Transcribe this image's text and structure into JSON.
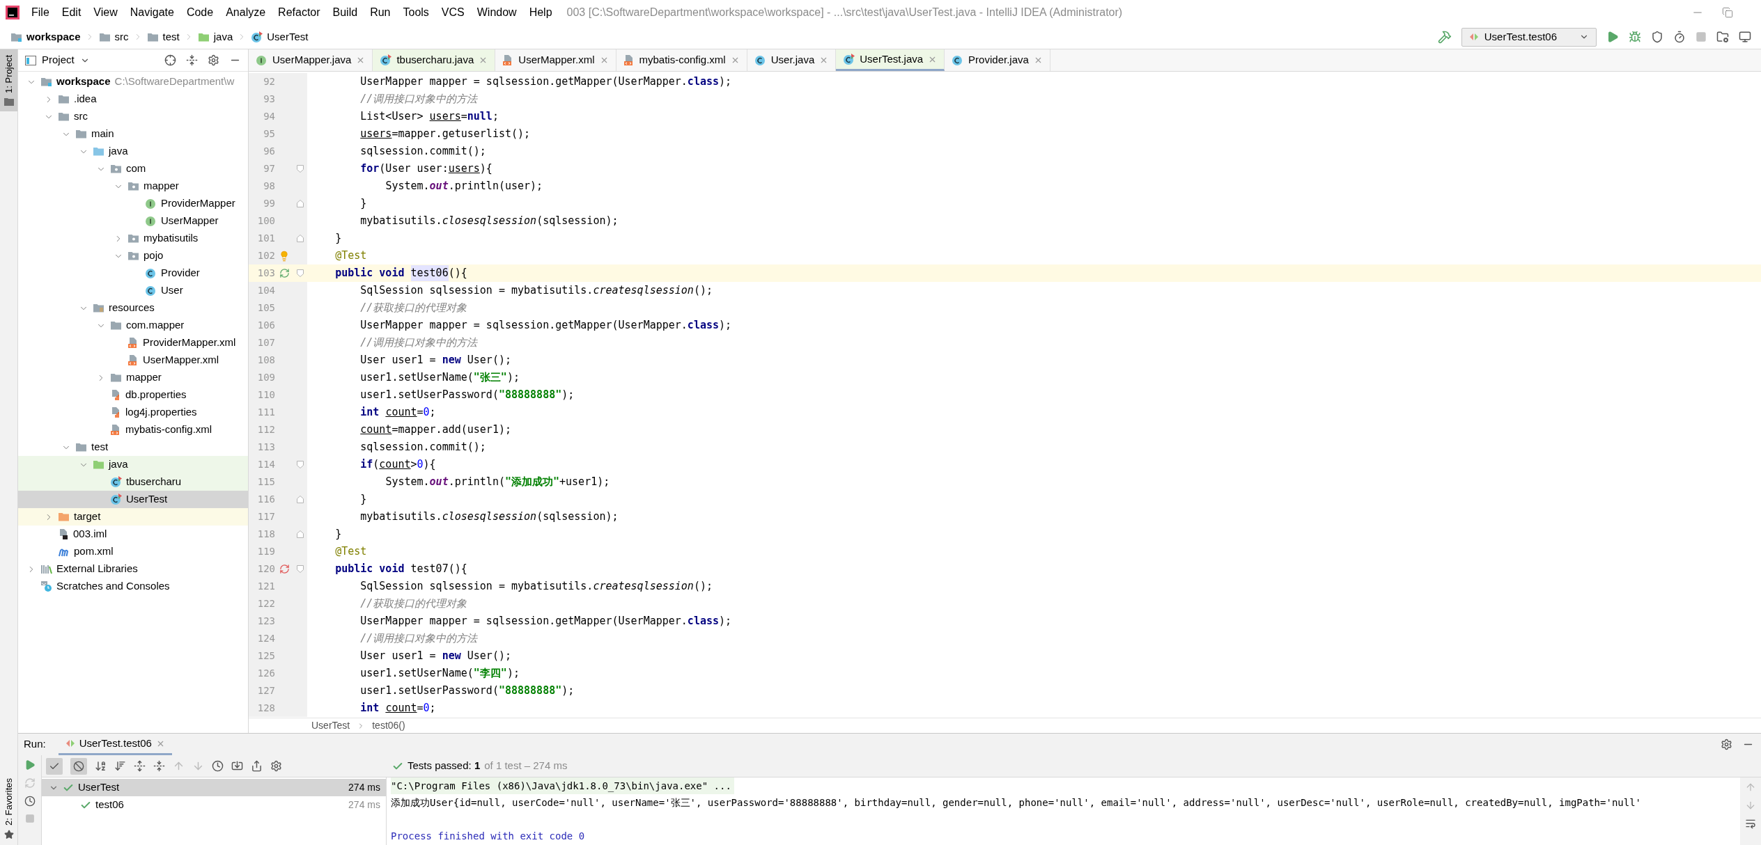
{
  "title_bar": {
    "menu": [
      "File",
      "Edit",
      "View",
      "Navigate",
      "Code",
      "Analyze",
      "Refactor",
      "Build",
      "Run",
      "Tools",
      "VCS",
      "Window",
      "Help"
    ],
    "title": "003 [C:\\SoftwareDepartment\\workspace\\workspace] - ...\\src\\test\\java\\UserTest.java - IntelliJ IDEA (Administrator)"
  },
  "nav_bar": {
    "breadcrumb": [
      {
        "label": "workspace",
        "kind": "module"
      },
      {
        "label": "src",
        "kind": "folder"
      },
      {
        "label": "test",
        "kind": "folder"
      },
      {
        "label": "java",
        "kind": "test-root"
      },
      {
        "label": "UserTest",
        "kind": "test-class"
      }
    ],
    "run_config": "UserTest.test06"
  },
  "tool_strip": [
    {
      "label": "1: Project",
      "kind": "project",
      "selected": true
    },
    {
      "label": "2: Favorites",
      "kind": "favorites",
      "selected": false
    }
  ],
  "project_panel": {
    "title": "Project",
    "tree": [
      {
        "label": "workspace",
        "kind": "module",
        "path": "C:\\SoftwareDepartment\\w",
        "expanded": true,
        "selected": false,
        "children": [
          {
            "label": ".idea",
            "kind": "folder",
            "expanded": false,
            "selected": false
          },
          {
            "label": "src",
            "kind": "folder",
            "expanded": true,
            "selected": false,
            "children": [
              {
                "label": "main",
                "kind": "folder",
                "expanded": true,
                "selected": false,
                "children": [
                  {
                    "label": "java",
                    "kind": "source-root",
                    "expanded": true,
                    "selected": false,
                    "children": [
                      {
                        "label": "com",
                        "kind": "package",
                        "expanded": true,
                        "selected": false,
                        "children": [
                          {
                            "label": "mapper",
                            "kind": "package",
                            "expanded": true,
                            "selected": false,
                            "children": [
                              {
                                "label": "ProviderMapper",
                                "kind": "interface",
                                "selected": false
                              },
                              {
                                "label": "UserMapper",
                                "kind": "interface",
                                "selected": false
                              }
                            ]
                          },
                          {
                            "label": "mybatisutils",
                            "kind": "package",
                            "expanded": false,
                            "selected": false
                          },
                          {
                            "label": "pojo",
                            "kind": "package",
                            "expanded": true,
                            "selected": false,
                            "children": [
                              {
                                "label": "Provider",
                                "kind": "class",
                                "selected": false
                              },
                              {
                                "label": "User",
                                "kind": "class",
                                "selected": false
                              }
                            ]
                          }
                        ]
                      }
                    ]
                  },
                  {
                    "label": "resources",
                    "kind": "resources",
                    "expanded": true,
                    "selected": false,
                    "children": [
                      {
                        "label": "com.mapper",
                        "kind": "folder",
                        "expanded": true,
                        "selected": false,
                        "children": [
                          {
                            "label": "ProviderMapper.xml",
                            "kind": "xml",
                            "selected": false
                          },
                          {
                            "label": "UserMapper.xml",
                            "kind": "xml",
                            "selected": false
                          }
                        ]
                      },
                      {
                        "label": "mapper",
                        "kind": "folder",
                        "expanded": false,
                        "selected": false
                      },
                      {
                        "label": "db.properties",
                        "kind": "properties",
                        "selected": false
                      },
                      {
                        "label": "log4j.properties",
                        "kind": "properties",
                        "selected": false
                      },
                      {
                        "label": "mybatis-config.xml",
                        "kind": "xml",
                        "selected": false
                      }
                    ]
                  }
                ]
              },
              {
                "label": "test",
                "kind": "folder",
                "expanded": true,
                "selected": false,
                "children": [
                  {
                    "label": "java",
                    "kind": "test-root",
                    "expanded": true,
                    "selected": false,
                    "children": [
                      {
                        "label": "tbusercharu",
                        "kind": "test-class",
                        "selected": false
                      },
                      {
                        "label": "UserTest",
                        "kind": "test-class",
                        "selected": true
                      }
                    ]
                  }
                ]
              }
            ]
          },
          {
            "label": "target",
            "kind": "excluded",
            "expanded": false,
            "selected": false
          },
          {
            "label": "003.iml",
            "kind": "iml",
            "selected": false
          },
          {
            "label": "pom.xml",
            "kind": "maven",
            "selected": false
          }
        ]
      },
      {
        "label": "External Libraries",
        "kind": "libraries",
        "expanded": false,
        "selected": false
      },
      {
        "label": "Scratches and Consoles",
        "kind": "scratches",
        "selected": false
      }
    ]
  },
  "editor_tabs": [
    {
      "label": "UserMapper.java",
      "kind": "interface",
      "selected": false
    },
    {
      "label": "tbusercharu.java",
      "kind": "test-class",
      "selected": false
    },
    {
      "label": "UserMapper.xml",
      "kind": "xml",
      "selected": false
    },
    {
      "label": "mybatis-config.xml",
      "kind": "xml",
      "selected": false
    },
    {
      "label": "User.java",
      "kind": "class",
      "selected": false
    },
    {
      "label": "UserTest.java",
      "kind": "test-class",
      "selected": true
    },
    {
      "label": "Provider.java",
      "kind": "class",
      "selected": false
    }
  ],
  "editor": {
    "lines": [
      {
        "number": "92",
        "tokens": [
          {
            "kind": "plain",
            "text": "        UserMapper mapper = sqlsession.getMapper(UserMapper."
          },
          {
            "kind": "keyword",
            "text": "class"
          },
          {
            "kind": "plain",
            "text": ");"
          }
        ]
      },
      {
        "number": "93",
        "tokens": [
          {
            "kind": "comment",
            "text": "        //调用接口对象中的方法"
          }
        ]
      },
      {
        "number": "94",
        "tokens": [
          {
            "kind": "plain",
            "text": "        List<User> "
          },
          {
            "kind": "reassigned",
            "text": "users"
          },
          {
            "kind": "plain",
            "text": "="
          },
          {
            "kind": "keyword",
            "text": "null"
          },
          {
            "kind": "plain",
            "text": ";"
          }
        ]
      },
      {
        "number": "95",
        "tokens": [
          {
            "kind": "reassigned",
            "text": "        users"
          },
          {
            "kind": "plain",
            "text": "=mapper.getuserlist();"
          }
        ]
      },
      {
        "number": "96",
        "tokens": [
          {
            "kind": "plain",
            "text": "        sqlsession.commit();"
          }
        ]
      },
      {
        "number": "97",
        "fold_start": true,
        "tokens": [
          {
            "kind": "keyword",
            "text": "        for"
          },
          {
            "kind": "plain",
            "text": "(User user:"
          },
          {
            "kind": "reassigned",
            "text": "users"
          },
          {
            "kind": "plain",
            "text": "){"
          }
        ]
      },
      {
        "number": "98",
        "tokens": [
          {
            "kind": "plain",
            "text": "            System."
          },
          {
            "kind": "field",
            "text": "out"
          },
          {
            "kind": "plain",
            "text": ".println(user);"
          }
        ]
      },
      {
        "number": "99",
        "fold_end": true,
        "tokens": [
          {
            "kind": "plain",
            "text": "        }"
          }
        ]
      },
      {
        "number": "100",
        "tokens": [
          {
            "kind": "plain",
            "text": "        mybatisutils."
          },
          {
            "kind": "static",
            "text": "closesqlsession"
          },
          {
            "kind": "plain",
            "text": "(sqlsession);"
          }
        ]
      },
      {
        "number": "101",
        "fold_end": true,
        "tokens": [
          {
            "kind": "plain",
            "text": "    }"
          }
        ]
      },
      {
        "number": "102",
        "intention_bulb": true,
        "tokens": [
          {
            "kind": "annotation",
            "text": "    @Test"
          }
        ]
      },
      {
        "number": "103",
        "test_passed": true,
        "fold_start": true,
        "current": true,
        "tokens": [
          {
            "kind": "keyword",
            "text": "    public void "
          },
          {
            "kind": "highlight",
            "text": "test06"
          },
          {
            "kind": "plain",
            "text": "(){"
          }
        ]
      },
      {
        "number": "104",
        "tokens": [
          {
            "kind": "plain",
            "text": "        SqlSession sqlsession = mybatisutils."
          },
          {
            "kind": "static",
            "text": "createsqlsession"
          },
          {
            "kind": "plain",
            "text": "();"
          }
        ]
      },
      {
        "number": "105",
        "tokens": [
          {
            "kind": "comment",
            "text": "        //获取接口的代理对象"
          }
        ]
      },
      {
        "number": "106",
        "tokens": [
          {
            "kind": "plain",
            "text": "        UserMapper mapper = sqlsession.getMapper(UserMapper."
          },
          {
            "kind": "keyword",
            "text": "class"
          },
          {
            "kind": "plain",
            "text": ");"
          }
        ]
      },
      {
        "number": "107",
        "tokens": [
          {
            "kind": "comment",
            "text": "        //调用接口对象中的方法"
          }
        ]
      },
      {
        "number": "108",
        "tokens": [
          {
            "kind": "plain",
            "text": "        User user1 = "
          },
          {
            "kind": "keyword",
            "text": "new"
          },
          {
            "kind": "plain",
            "text": " User();"
          }
        ]
      },
      {
        "number": "109",
        "tokens": [
          {
            "kind": "plain",
            "text": "        user1.setUserName("
          },
          {
            "kind": "string",
            "text": "\"张三\""
          },
          {
            "kind": "plain",
            "text": ");"
          }
        ]
      },
      {
        "number": "110",
        "tokens": [
          {
            "kind": "plain",
            "text": "        user1.setUserPassword("
          },
          {
            "kind": "string",
            "text": "\"88888888\""
          },
          {
            "kind": "plain",
            "text": ");"
          }
        ]
      },
      {
        "number": "111",
        "tokens": [
          {
            "kind": "keyword",
            "text": "        int "
          },
          {
            "kind": "reassigned",
            "text": "count"
          },
          {
            "kind": "plain",
            "text": "="
          },
          {
            "kind": "number",
            "text": "0"
          },
          {
            "kind": "plain",
            "text": ";"
          }
        ]
      },
      {
        "number": "112",
        "tokens": [
          {
            "kind": "reassigned",
            "text": "        count"
          },
          {
            "kind": "plain",
            "text": "=mapper.add(user1);"
          }
        ]
      },
      {
        "number": "113",
        "tokens": [
          {
            "kind": "plain",
            "text": "        sqlsession.commit();"
          }
        ]
      },
      {
        "number": "114",
        "fold_start": true,
        "tokens": [
          {
            "kind": "keyword",
            "text": "        if"
          },
          {
            "kind": "plain",
            "text": "("
          },
          {
            "kind": "reassigned",
            "text": "count"
          },
          {
            "kind": "plain",
            "text": ">"
          },
          {
            "kind": "number",
            "text": "0"
          },
          {
            "kind": "plain",
            "text": "){"
          }
        ]
      },
      {
        "number": "115",
        "tokens": [
          {
            "kind": "plain",
            "text": "            System."
          },
          {
            "kind": "field",
            "text": "out"
          },
          {
            "kind": "plain",
            "text": ".println("
          },
          {
            "kind": "string",
            "text": "\"添加成功\""
          },
          {
            "kind": "plain",
            "text": "+user1);"
          }
        ]
      },
      {
        "number": "116",
        "fold_end": true,
        "tokens": [
          {
            "kind": "plain",
            "text": "        }"
          }
        ]
      },
      {
        "number": "117",
        "tokens": [
          {
            "kind": "plain",
            "text": "        mybatisutils."
          },
          {
            "kind": "static",
            "text": "closesqlsession"
          },
          {
            "kind": "plain",
            "text": "(sqlsession);"
          }
        ]
      },
      {
        "number": "118",
        "fold_end": true,
        "tokens": [
          {
            "kind": "plain",
            "text": "    }"
          }
        ]
      },
      {
        "number": "119",
        "tokens": [
          {
            "kind": "annotation",
            "text": "    @Test"
          }
        ]
      },
      {
        "number": "120",
        "test_passed": false,
        "fold_start": true,
        "tokens": [
          {
            "kind": "keyword",
            "text": "    public void"
          },
          {
            "kind": "plain",
            "text": " test07(){"
          }
        ]
      },
      {
        "number": "121",
        "tokens": [
          {
            "kind": "plain",
            "text": "        SqlSession sqlsession = mybatisutils."
          },
          {
            "kind": "static",
            "text": "createsqlsession"
          },
          {
            "kind": "plain",
            "text": "();"
          }
        ]
      },
      {
        "number": "122",
        "tokens": [
          {
            "kind": "comment",
            "text": "        //获取接口的代理对象"
          }
        ]
      },
      {
        "number": "123",
        "tokens": [
          {
            "kind": "plain",
            "text": "        UserMapper mapper = sqlsession.getMapper(UserMapper."
          },
          {
            "kind": "keyword",
            "text": "class"
          },
          {
            "kind": "plain",
            "text": ");"
          }
        ]
      },
      {
        "number": "124",
        "tokens": [
          {
            "kind": "comment",
            "text": "        //调用接口对象中的方法"
          }
        ]
      },
      {
        "number": "125",
        "tokens": [
          {
            "kind": "plain",
            "text": "        User user1 = "
          },
          {
            "kind": "keyword",
            "text": "new"
          },
          {
            "kind": "plain",
            "text": " User();"
          }
        ]
      },
      {
        "number": "126",
        "tokens": [
          {
            "kind": "plain",
            "text": "        user1.setUserName("
          },
          {
            "kind": "string",
            "text": "\"李四\""
          },
          {
            "kind": "plain",
            "text": ");"
          }
        ]
      },
      {
        "number": "127",
        "tokens": [
          {
            "kind": "plain",
            "text": "        user1.setUserPassword("
          },
          {
            "kind": "string",
            "text": "\"88888888\""
          },
          {
            "kind": "plain",
            "text": ");"
          }
        ]
      },
      {
        "number": "128",
        "tokens": [
          {
            "kind": "keyword",
            "text": "        int "
          },
          {
            "kind": "reassigned",
            "text": "count"
          },
          {
            "kind": "plain",
            "text": "="
          },
          {
            "kind": "number",
            "text": "0"
          },
          {
            "kind": "plain",
            "text": ";"
          }
        ]
      }
    ],
    "breadcrumb": [
      "UserTest",
      "test06()"
    ]
  },
  "run_panel": {
    "label": "Run:",
    "tab": "UserTest.test06",
    "toolbar": [
      {
        "kind": "show-passed",
        "selected": true
      },
      {
        "kind": "show-ignored",
        "selected": true
      }
    ],
    "summary": {
      "passed": true,
      "label": "Tests passed: **1**",
      "detail": "of 1 test – 274 ms"
    },
    "tests": [
      {
        "label": "UserTest",
        "time": "274 ms",
        "passed": true,
        "expanded": true,
        "selected": true,
        "children": [
          {
            "label": "test06",
            "time": "274 ms",
            "passed": true,
            "selected": false
          }
        ]
      }
    ],
    "console": [
      {
        "kind": "command",
        "text": "\"C:\\Program Files (x86)\\Java\\jdk1.8.0_73\\bin\\java.exe\" ..."
      },
      {
        "kind": "output",
        "text": "添加成功User{id=null, userCode='null', userName='张三', userPassword='88888888', birthday=null, gender=null, phone='null', email='null', address='null', userDesc='null', userRole=null, createdBy=null, imgPath='null'"
      },
      {
        "kind": "status",
        "text": "Process finished with exit code 0"
      }
    ]
  }
}
